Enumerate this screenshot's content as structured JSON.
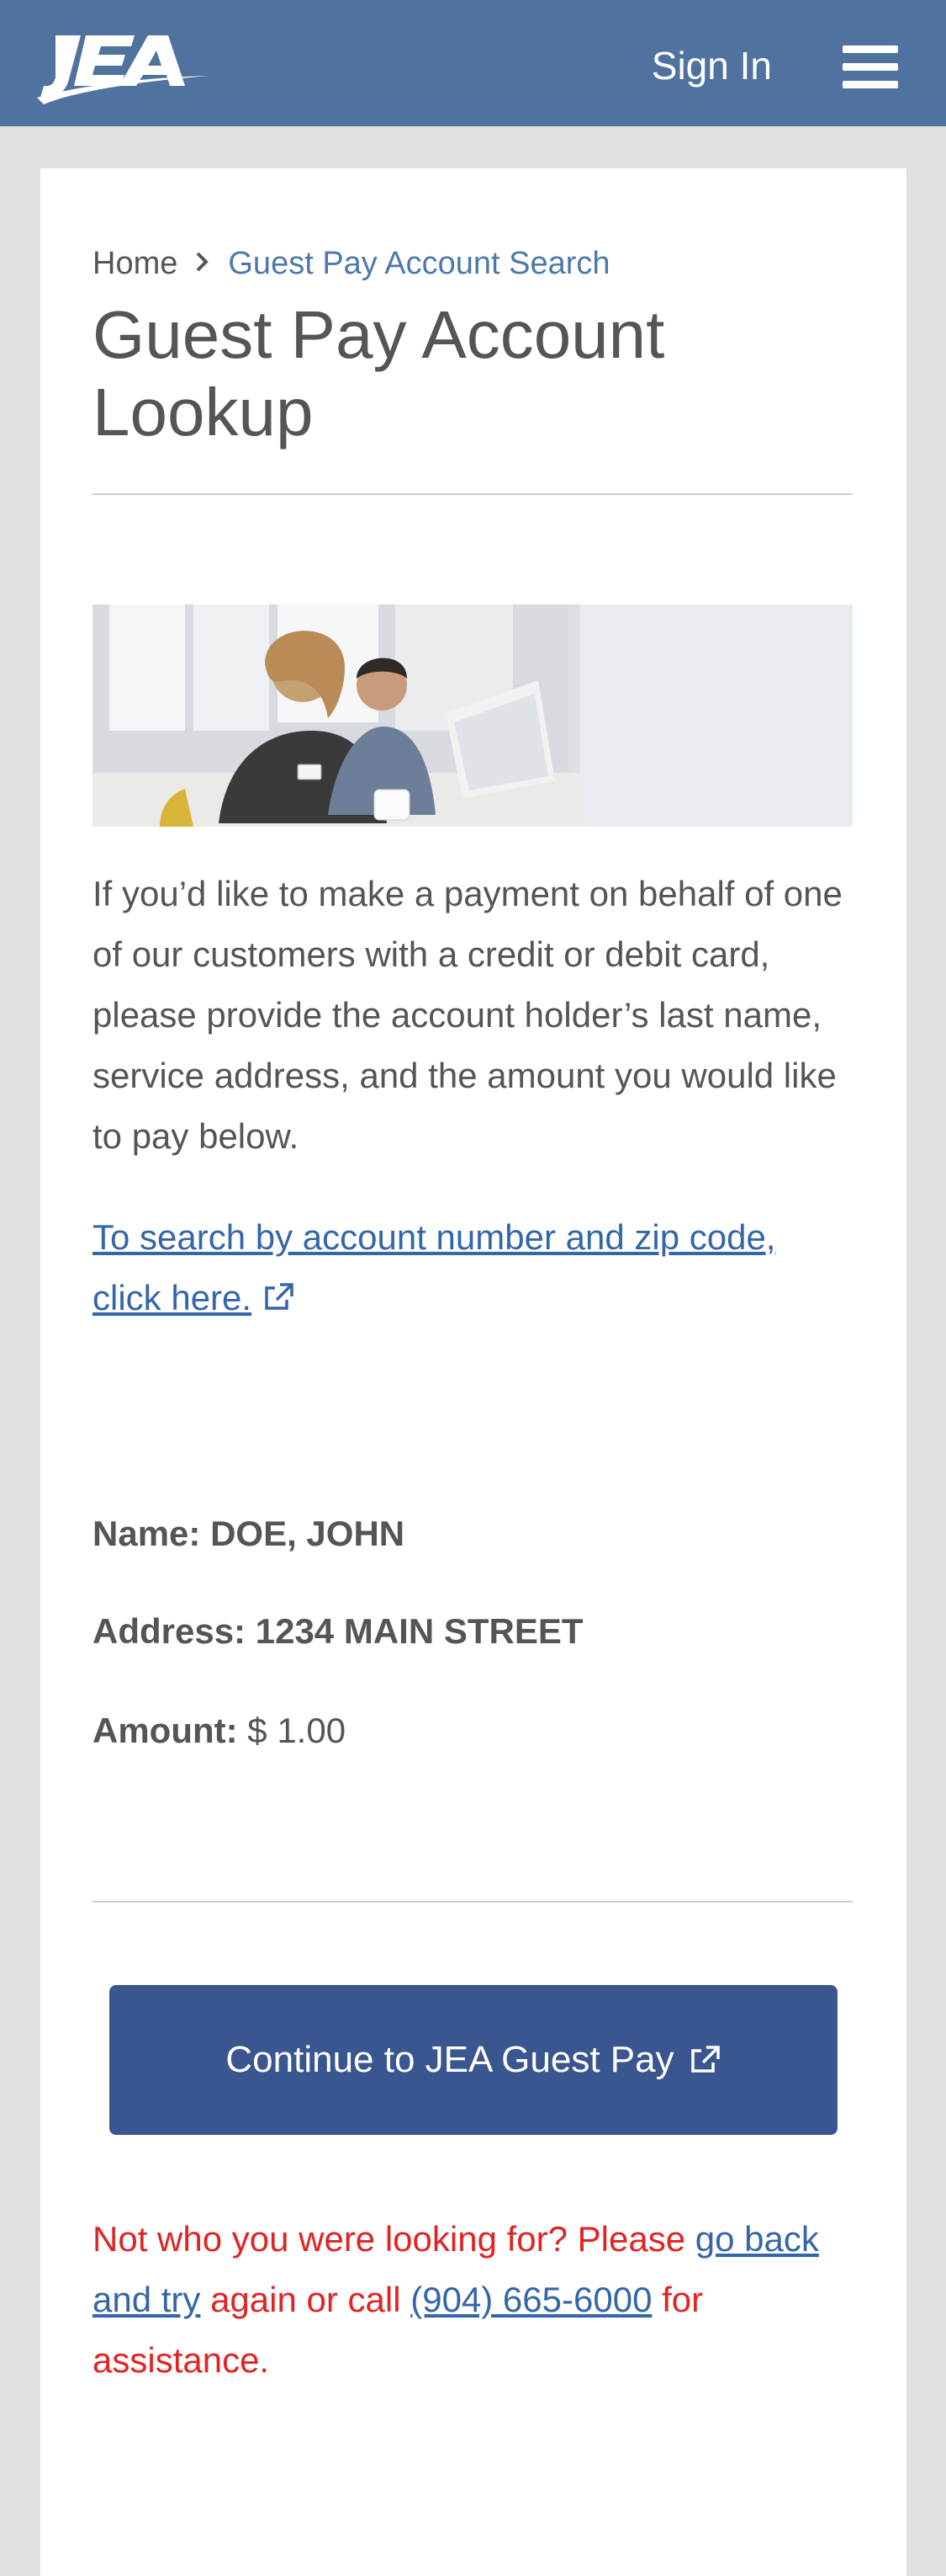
{
  "header": {
    "logo_text": "JEA",
    "sign_in_label": "Sign In",
    "menu_icon": "hamburger-menu-icon",
    "background_color": "#50729e"
  },
  "breadcrumb": {
    "home_label": "Home",
    "separator_icon": "chevron-right-icon",
    "current_label": "Guest Pay Account Search"
  },
  "page_title": "Guest Pay Account Lookup",
  "hero_image": {
    "description_icon": "customers-at-laptop-photo"
  },
  "intro_text": "If you’d like to make a payment on behalf of one of our customers with a credit or debit card, please provide the account holder’s last name, service address, and the amount you would like to pay below.",
  "search_link_label": "To search by account number and zip code, click here.",
  "account": {
    "name_label": "Name:",
    "name_value": "DOE, JOHN",
    "address_label": "Address:",
    "address_value": "1234 MAIN STREET",
    "amount_label": "Amount:",
    "amount_value": "$ 1.00"
  },
  "continue_button_label": "Continue to JEA Guest Pay",
  "notice": {
    "prefix": "Not who you were looking for? Please ",
    "go_back_link": "go back and try",
    "middle": " again or call ",
    "phone_link": "(904) 665-6000",
    "suffix": " for assistance."
  },
  "colors": {
    "button": "#3a5690",
    "link": "#3466a8",
    "notice": "#e12323"
  }
}
